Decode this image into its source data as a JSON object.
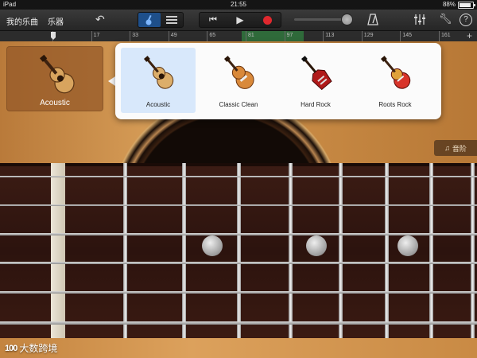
{
  "status_bar": {
    "device": "iPad",
    "time": "21:55",
    "battery": "88%",
    "battery_fraction": 0.88
  },
  "toolbar": {
    "my_songs": "我的乐曲",
    "instruments": "乐器",
    "volume_level": 0.9
  },
  "ruler": {
    "marks": [
      "1",
      "17",
      "33",
      "49",
      "65",
      "81",
      "97",
      "113",
      "129",
      "145",
      "161"
    ]
  },
  "current_instrument": {
    "label": "Acoustic"
  },
  "popover": {
    "items": [
      {
        "label": "Acoustic",
        "selected": true
      },
      {
        "label": "Classic Clean",
        "selected": false
      },
      {
        "label": "Hard Rock",
        "selected": false
      },
      {
        "label": "Roots Rock",
        "selected": false
      }
    ]
  },
  "scale_button": {
    "label": "音阶"
  },
  "watermark": {
    "logo": "100",
    "text": "大数跨境"
  }
}
